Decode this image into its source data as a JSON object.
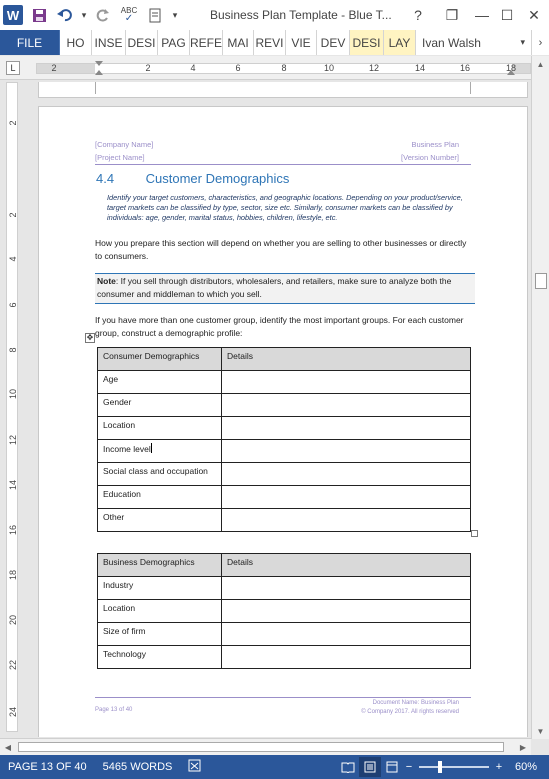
{
  "app": {
    "doc_title": "Business Plan Template - Blue T...",
    "colors": {
      "brand": "#2b579a",
      "header_text": "#9b8fc9",
      "heading": "#2e75b6",
      "guidance": "#1f3864",
      "table_header": "#d9d9d9"
    }
  },
  "qat": {
    "save_icon": "save-icon",
    "undo_icon": "undo-icon",
    "redo_icon": "redo-icon",
    "abc": "ABC"
  },
  "window": {
    "help": "?",
    "restore": "❐",
    "minimize": "—",
    "maximize": "☐",
    "close": "✕"
  },
  "ribbon": {
    "file_label": "FILE",
    "tabs": [
      {
        "label": "HO",
        "contextual": false
      },
      {
        "label": "INSE",
        "contextual": false
      },
      {
        "label": "DESI",
        "contextual": false
      },
      {
        "label": "PAG",
        "contextual": false
      },
      {
        "label": "REFE",
        "contextual": false
      },
      {
        "label": "MAI",
        "contextual": false
      },
      {
        "label": "REVI",
        "contextual": false
      },
      {
        "label": "VIE",
        "contextual": false
      },
      {
        "label": "DEV",
        "contextual": false
      },
      {
        "label": "DESI",
        "contextual": true
      },
      {
        "label": "LAY",
        "contextual": true
      }
    ],
    "user": "Ivan Walsh",
    "user_menu": "▾"
  },
  "ruler": {
    "tab_selector": "L",
    "labels": [
      "2",
      "2",
      "4",
      "6",
      "8",
      "10",
      "12",
      "14",
      "16",
      "18"
    ]
  },
  "vruler": {
    "labels": [
      "2",
      "2",
      "4",
      "6",
      "8",
      "10",
      "12",
      "14",
      "16",
      "18",
      "20",
      "22",
      "24"
    ]
  },
  "page": {
    "header": {
      "company": "[Company Name]",
      "project": "[Project Name]",
      "doc": "Business Plan",
      "version": "[Version Number]"
    },
    "section_number": "4.4",
    "section_title": "Customer Demographics",
    "guidance": "Identify your target customers, characteristics, and geographic locations. Depending on your product/service, target markets can be classified by type, sector, size etc. Similarly, consumer markets can be classified by individuals: age, gender, marital status, hobbies, children, lifestyle, etc.",
    "para1": "How you prepare this section will depend on whether you are selling to other businesses or directly to consumers.",
    "note_label": "Note",
    "note_text": ": If you sell through distributors, wholesalers, and retailers, make sure to analyze both the consumer and middleman to which you sell.",
    "para2": "If you have more than one customer group, identify the most important groups. For each customer group, construct a demographic profile:",
    "consumer_table": {
      "headers": [
        "Consumer Demographics",
        "Details"
      ],
      "rows": [
        "Age",
        "Gender",
        "Location",
        "Income level",
        "Social class and occupation",
        "Education",
        "Other"
      ]
    },
    "business_table": {
      "headers": [
        "Business Demographics",
        "Details"
      ],
      "rows": [
        "Industry",
        "Location",
        "Size of firm",
        "Technology"
      ]
    },
    "footer": {
      "page": "Page 13 of 40",
      "doc_name": "Document Name: Business Plan",
      "copyright": "© Company 2017. All rights reserved"
    }
  },
  "status": {
    "page": "PAGE 13 OF 40",
    "words": "5465 WORDS",
    "zoom": "60%",
    "zoom_level": 0.6,
    "zoom_out": "−",
    "zoom_in": "+"
  }
}
